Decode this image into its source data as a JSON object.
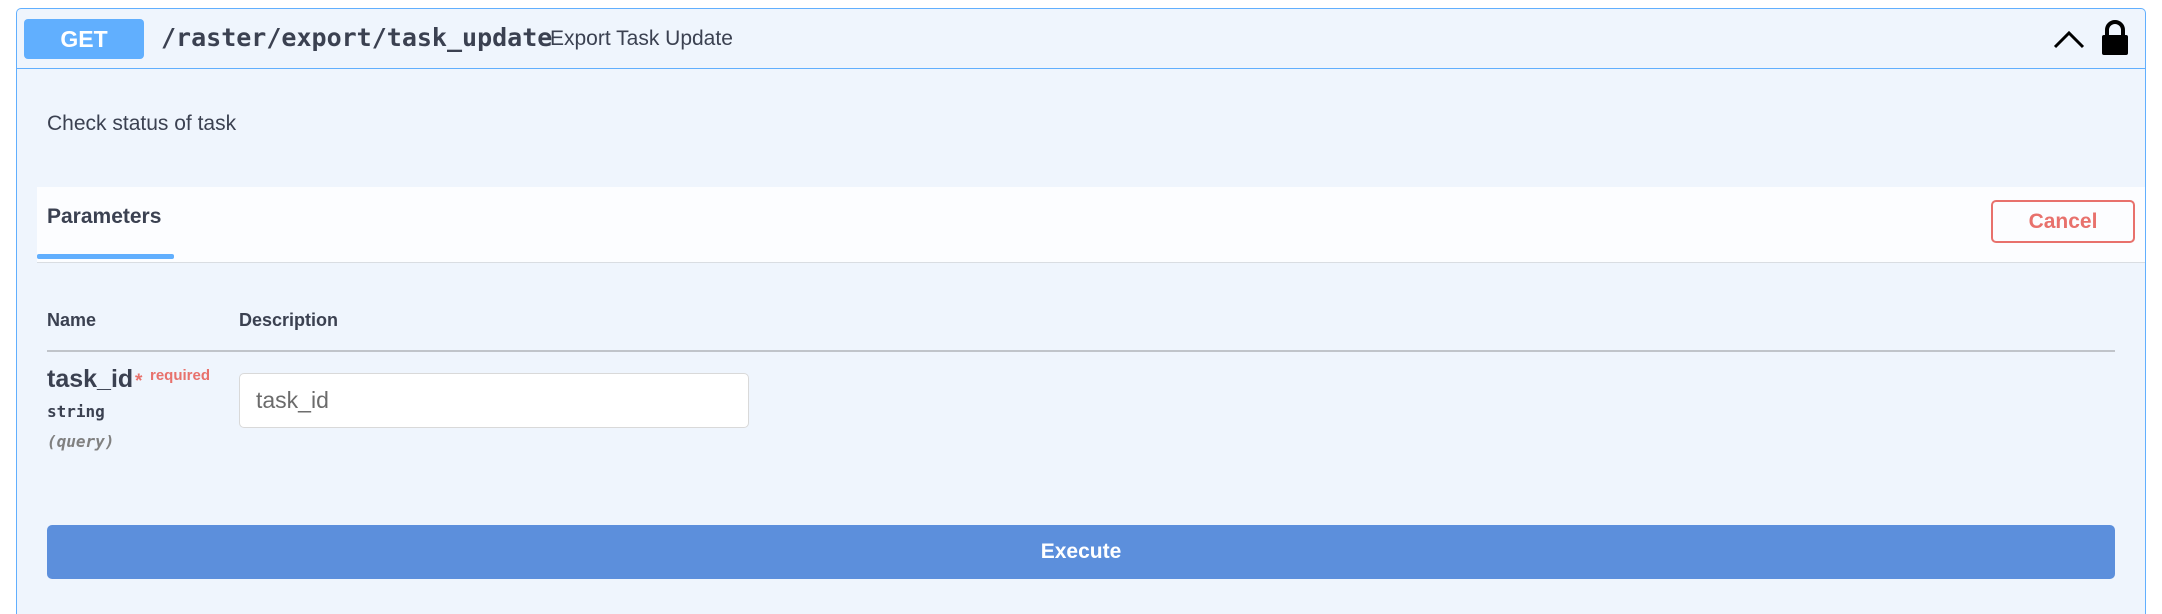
{
  "operation": {
    "method": "GET",
    "path": "/raster/export/task_update",
    "summary": "Export Task Update",
    "description": "Check status of task",
    "method_color": "#61affe"
  },
  "icons": {
    "collapse": "chevron-up-icon",
    "auth": "lock-icon"
  },
  "parameters_section": {
    "tab_label": "Parameters",
    "cancel_label": "Cancel",
    "cancel_color": "#e8716c",
    "columns": [
      "Name",
      "Description"
    ],
    "params": [
      {
        "name": "task_id",
        "required_marker": "*",
        "required_label": "required",
        "type": "string",
        "in": "(query)",
        "placeholder": "task_id",
        "value": ""
      }
    ]
  },
  "execute_label": "Execute",
  "execute_color": "#5c8fdc"
}
